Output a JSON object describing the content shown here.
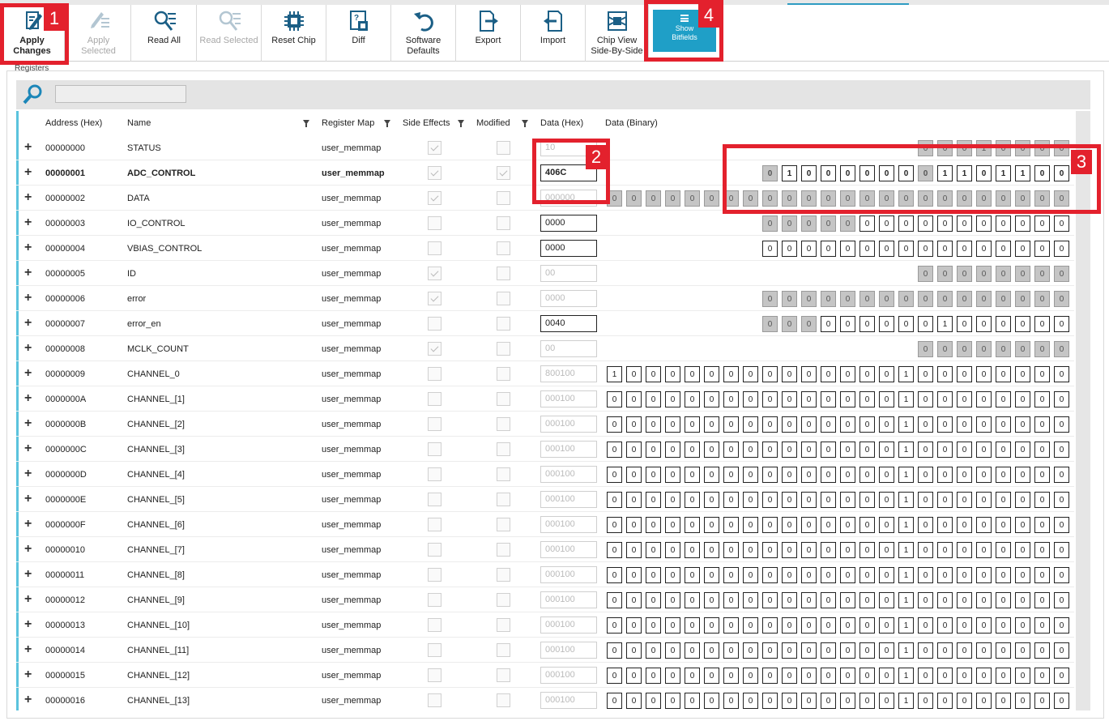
{
  "toolbar": {
    "buttons": [
      {
        "id": "apply-changes",
        "label": "Apply Changes",
        "icon": "pen-icon",
        "enabled": true
      },
      {
        "id": "apply-selected",
        "label": "Apply Selected",
        "icon": "pen-list-icon",
        "enabled": false
      },
      {
        "id": "read-all",
        "label": "Read All",
        "icon": "read-magnifier-icon",
        "enabled": true
      },
      {
        "id": "read-selected",
        "label": "Read Selected",
        "icon": "read-selected-icon",
        "enabled": false
      },
      {
        "id": "reset-chip",
        "label": "Reset Chip",
        "icon": "chip-icon",
        "enabled": true
      },
      {
        "id": "diff",
        "label": "Diff",
        "icon": "diff-icon",
        "enabled": true
      },
      {
        "id": "software-defaults",
        "label": "Software Defaults",
        "icon": "undo-arrow-icon",
        "enabled": true
      },
      {
        "id": "export",
        "label": "Export",
        "icon": "export-icon",
        "enabled": true
      },
      {
        "id": "import",
        "label": "Import",
        "icon": "import-icon",
        "enabled": true
      },
      {
        "id": "chip-view",
        "label": "Chip View Side-By-Side",
        "icon": "chip-view-icon",
        "enabled": true
      }
    ],
    "show_bitfields": {
      "label": "Show Bitfields",
      "icon": "bitfield-icon",
      "active": true
    }
  },
  "registers_label": "Registers",
  "search": {
    "value": "",
    "icon": "search-icon"
  },
  "columns": {
    "address": "Address (Hex)",
    "name": "Name",
    "register_map": "Register Map",
    "side_effects": "Side Effects",
    "modified": "Modified",
    "data_hex": "Data (Hex)",
    "data_binary": "Data (Binary)"
  },
  "rows": [
    {
      "address": "00000000",
      "name": "STATUS",
      "map": "user_memmap",
      "side_effects": true,
      "modified": false,
      "hex": "10",
      "hex_ro": true,
      "bits": "00010000",
      "ro": "11111111"
    },
    {
      "address": "00000001",
      "name": "ADC_CONTROL",
      "map": "user_memmap",
      "side_effects": true,
      "modified": true,
      "hex": "406C",
      "hex_ro": false,
      "bold": true,
      "bits": "0100000001101100",
      "ro": "1000000010000000"
    },
    {
      "address": "00000002",
      "name": "DATA",
      "map": "user_memmap",
      "side_effects": true,
      "modified": false,
      "hex": "000000",
      "hex_ro": true,
      "bits": "000000000000000000000000",
      "ro": "111111111111111111111111"
    },
    {
      "address": "00000003",
      "name": "IO_CONTROL",
      "map": "user_memmap",
      "side_effects": false,
      "modified": false,
      "hex": "0000",
      "hex_ro": false,
      "bits": "0000000000000000",
      "ro": "1111100000000000"
    },
    {
      "address": "00000004",
      "name": "VBIAS_CONTROL",
      "map": "user_memmap",
      "side_effects": false,
      "modified": false,
      "hex": "0000",
      "hex_ro": false,
      "bits": "0000000000000000",
      "ro": "0000000000000000"
    },
    {
      "address": "00000005",
      "name": "ID",
      "map": "user_memmap",
      "side_effects": true,
      "modified": false,
      "hex": "00",
      "hex_ro": true,
      "bits": "00000000",
      "ro": "11111111"
    },
    {
      "address": "00000006",
      "name": "error",
      "map": "user_memmap",
      "side_effects": true,
      "modified": false,
      "hex": "0000",
      "hex_ro": true,
      "bits": "0000000000000000",
      "ro": "1111111111111111"
    },
    {
      "address": "00000007",
      "name": "error_en",
      "map": "user_memmap",
      "side_effects": false,
      "modified": false,
      "hex": "0040",
      "hex_ro": false,
      "bits": "0000000001000000",
      "ro": "1110000000000000"
    },
    {
      "address": "00000008",
      "name": "MCLK_COUNT",
      "map": "user_memmap",
      "side_effects": true,
      "modified": false,
      "hex": "00",
      "hex_ro": true,
      "bits": "00000000",
      "ro": "11111111"
    },
    {
      "address": "00000009",
      "name": "CHANNEL_0",
      "map": "user_memmap",
      "side_effects": false,
      "modified": false,
      "hex": "800100",
      "hex_ro": true,
      "bits": "100000000000000100000000",
      "ro": "000000000000000000000000"
    },
    {
      "address": "0000000A",
      "name": "CHANNEL_[1]",
      "map": "user_memmap",
      "side_effects": false,
      "modified": false,
      "hex": "000100",
      "hex_ro": true,
      "bits": "000000000000000100000000",
      "ro": "000000000000000000000000"
    },
    {
      "address": "0000000B",
      "name": "CHANNEL_[2]",
      "map": "user_memmap",
      "side_effects": false,
      "modified": false,
      "hex": "000100",
      "hex_ro": true,
      "bits": "000000000000000100000000",
      "ro": "000000000000000000000000"
    },
    {
      "address": "0000000C",
      "name": "CHANNEL_[3]",
      "map": "user_memmap",
      "side_effects": false,
      "modified": false,
      "hex": "000100",
      "hex_ro": true,
      "bits": "000000000000000100000000",
      "ro": "000000000000000000000000"
    },
    {
      "address": "0000000D",
      "name": "CHANNEL_[4]",
      "map": "user_memmap",
      "side_effects": false,
      "modified": false,
      "hex": "000100",
      "hex_ro": true,
      "bits": "000000000000000100000000",
      "ro": "000000000000000000000000"
    },
    {
      "address": "0000000E",
      "name": "CHANNEL_[5]",
      "map": "user_memmap",
      "side_effects": false,
      "modified": false,
      "hex": "000100",
      "hex_ro": true,
      "bits": "000000000000000100000000",
      "ro": "000000000000000000000000"
    },
    {
      "address": "0000000F",
      "name": "CHANNEL_[6]",
      "map": "user_memmap",
      "side_effects": false,
      "modified": false,
      "hex": "000100",
      "hex_ro": true,
      "bits": "000000000000000100000000",
      "ro": "000000000000000000000000"
    },
    {
      "address": "00000010",
      "name": "CHANNEL_[7]",
      "map": "user_memmap",
      "side_effects": false,
      "modified": false,
      "hex": "000100",
      "hex_ro": true,
      "bits": "000000000000000100000000",
      "ro": "000000000000000000000000"
    },
    {
      "address": "00000011",
      "name": "CHANNEL_[8]",
      "map": "user_memmap",
      "side_effects": false,
      "modified": false,
      "hex": "000100",
      "hex_ro": true,
      "bits": "000000000000000100000000",
      "ro": "000000000000000000000000"
    },
    {
      "address": "00000012",
      "name": "CHANNEL_[9]",
      "map": "user_memmap",
      "side_effects": false,
      "modified": false,
      "hex": "000100",
      "hex_ro": true,
      "bits": "000000000000000100000000",
      "ro": "000000000000000000000000"
    },
    {
      "address": "00000013",
      "name": "CHANNEL_[10]",
      "map": "user_memmap",
      "side_effects": false,
      "modified": false,
      "hex": "000100",
      "hex_ro": true,
      "bits": "000000000000000100000000",
      "ro": "000000000000000000000000"
    },
    {
      "address": "00000014",
      "name": "CHANNEL_[11]",
      "map": "user_memmap",
      "side_effects": false,
      "modified": false,
      "hex": "000100",
      "hex_ro": true,
      "bits": "000000000000000100000000",
      "ro": "000000000000000000000000"
    },
    {
      "address": "00000015",
      "name": "CHANNEL_[12]",
      "map": "user_memmap",
      "side_effects": false,
      "modified": false,
      "hex": "000100",
      "hex_ro": true,
      "bits": "000000000000000100000000",
      "ro": "000000000000000000000000"
    },
    {
      "address": "00000016",
      "name": "CHANNEL_[13]",
      "map": "user_memmap",
      "side_effects": false,
      "modified": false,
      "hex": "000100",
      "hex_ro": true,
      "bits": "000000000000000100000000",
      "ro": "000000000000000000000000"
    }
  ],
  "annotations": [
    {
      "number": "1"
    },
    {
      "number": "2"
    },
    {
      "number": "3"
    },
    {
      "number": "4"
    }
  ],
  "colors": {
    "accent": "#1f9fc7",
    "callout": "#e3212d",
    "readonly_bit": "#c5c5c5",
    "row_marker": "#5bc3dd"
  }
}
